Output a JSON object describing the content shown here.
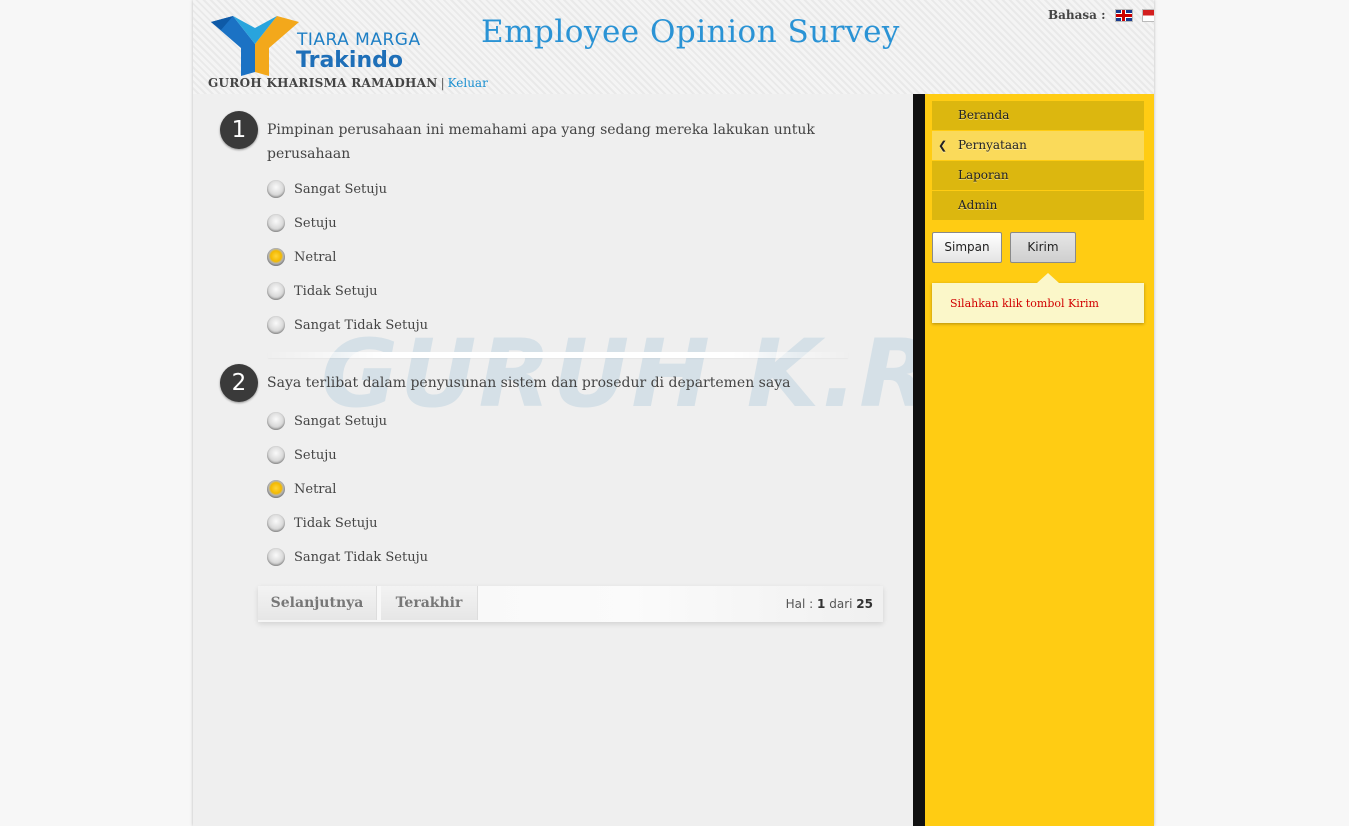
{
  "header": {
    "brand_top": "TIARA MARGA",
    "brand_bottom": "Trakindo",
    "user_name": "GUROH KHARISMA RAMADHAN",
    "separator": "|",
    "logout_label": "Keluar",
    "survey_title": "Employee Opinion Survey",
    "language_label": "Bahasa :",
    "languages": [
      "english-flag-icon",
      "indonesia-flag-icon"
    ]
  },
  "watermark": "GURUH K.R",
  "questions": [
    {
      "number": "1",
      "text": "Pimpinan perusahaan ini memahami apa yang sedang mereka lakukan untuk perusahaan",
      "options": [
        "Sangat Setuju",
        "Setuju",
        "Netral",
        "Tidak Setuju",
        "Sangat Tidak Setuju"
      ],
      "selected": "Netral"
    },
    {
      "number": "2",
      "text": "Saya terlibat dalam penyusunan sistem dan prosedur di departemen saya",
      "options": [
        "Sangat Setuju",
        "Setuju",
        "Netral",
        "Tidak Setuju",
        "Sangat Tidak Setuju"
      ],
      "selected": "Netral"
    }
  ],
  "pager": {
    "next_label": "Selanjutnya",
    "last_label": "Terakhir",
    "hal_label": "Hal :",
    "current_page": "1",
    "of_label": "dari",
    "total_pages": "25"
  },
  "sidebar": {
    "menu": [
      {
        "label": "Beranda",
        "active": false
      },
      {
        "label": "Pernyataan",
        "active": true
      },
      {
        "label": "Laporan",
        "active": false
      },
      {
        "label": "Admin",
        "active": false
      }
    ],
    "save_label": "Simpan",
    "submit_label": "Kirim",
    "tooltip": "Silahkan klik tombol Kirim"
  },
  "colors": {
    "accent_blue": "#2a93d5",
    "sidebar_yellow": "#ffcc13",
    "menu_item": "#dcb70f",
    "menu_active": "#fada5a",
    "tooltip_text": "#d10000"
  }
}
